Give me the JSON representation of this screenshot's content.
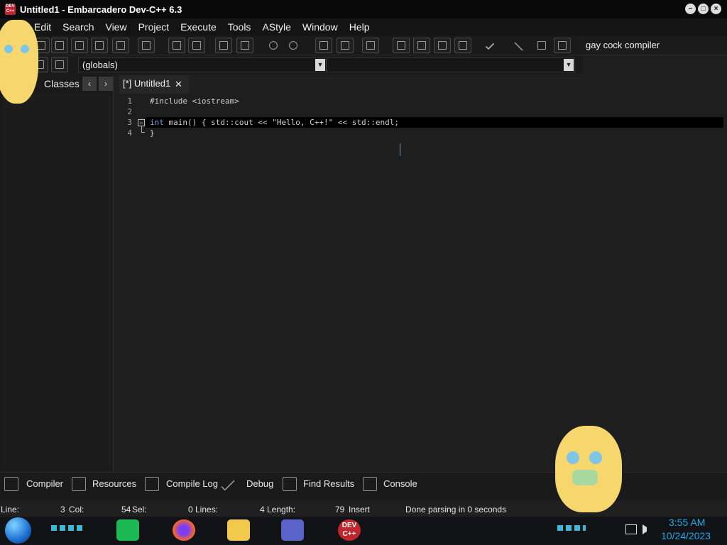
{
  "window": {
    "title": "Untitled1 - Embarcadero Dev-C++ 6.3",
    "app_icon_text": "DEV C++"
  },
  "menu": [
    "Edit",
    "Search",
    "View",
    "Project",
    "Execute",
    "Tools",
    "AStyle",
    "Window",
    "Help"
  ],
  "toolbar": {
    "compiler_name": "gay cock compiler",
    "scope_select_value": "(globals)"
  },
  "left_panel": {
    "tab_label": "Classes",
    "prev_arrow": "‹",
    "next_arrow": "›"
  },
  "editor": {
    "tab_label": "[*] Untitled1",
    "tab_close": "✕",
    "lines": [
      {
        "number": "1",
        "text": "#include <iostream>"
      },
      {
        "number": "2",
        "text": ""
      },
      {
        "number": "3",
        "keyword": "int",
        "text": " main() { std::cout << \"Hello, C++!\" << std::endl;"
      },
      {
        "number": "4",
        "text": "}"
      }
    ],
    "fold_marker": "−"
  },
  "bottom_tabs": [
    "Compiler",
    "Resources",
    "Compile Log",
    "Debug",
    "Find Results",
    "Console"
  ],
  "status": {
    "line_label": "Line:",
    "line_value": "3",
    "col_label": "Col:",
    "col_value": "54",
    "sel_label": "Sel:",
    "sel_value": "0",
    "lines_label": "Lines:",
    "lines_value": "4",
    "length_label": "Length:",
    "length_value": "79",
    "mode": "Insert",
    "message": "Done parsing in 0 seconds"
  },
  "taskbar": {
    "time": "3:55 AM",
    "date": "10/24/2023",
    "devcpp_icon_text": "DEV C++",
    "icons": [
      "windows-orb-icon",
      "spotify-icon",
      "firefox-icon",
      "file-explorer-icon",
      "control-panel-icon",
      "devcpp-icon",
      "network-icon",
      "volume-icon"
    ]
  },
  "colors": {
    "accent_clock": "#23a8e4",
    "devcpp_red": "#c0262d",
    "keyword_blue": "#77a8d8"
  }
}
